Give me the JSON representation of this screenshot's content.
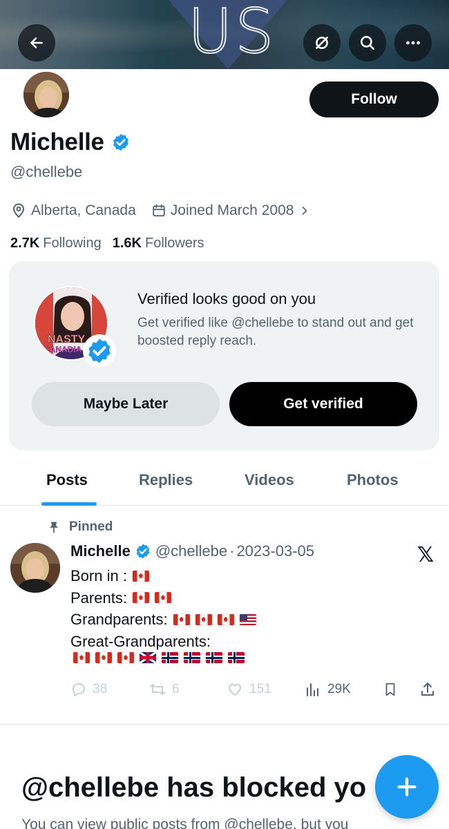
{
  "banner": {
    "text": "US"
  },
  "header": {
    "follow_label": "Follow",
    "name": "Michelle",
    "handle": "@chellebe",
    "location": "Alberta, Canada",
    "joined": "Joined March 2008",
    "following_count": "2.7K",
    "following_label": "Following",
    "followers_count": "1.6K",
    "followers_label": "Followers"
  },
  "verify_card": {
    "title": "Verified looks good on you",
    "description": "Get verified like @chellebe to stand out and get boosted reply reach.",
    "avatar_text_1": "NASTY",
    "avatar_text_2": "CANADIA",
    "later_label": "Maybe Later",
    "verify_label": "Get verified"
  },
  "tabs": [
    {
      "label": "Posts",
      "active": true
    },
    {
      "label": "Replies",
      "active": false
    },
    {
      "label": "Videos",
      "active": false
    },
    {
      "label": "Photos",
      "active": false
    }
  ],
  "post": {
    "pinned_label": "Pinned",
    "author": "Michelle",
    "handle": "@chellebe",
    "separator": "·",
    "date": "2023-03-05",
    "lines": [
      {
        "text": "Born in :",
        "flags": [
          "ca"
        ]
      },
      {
        "text": "Parents:",
        "flags": [
          "ca",
          "ca"
        ]
      },
      {
        "text": "Grandparents:",
        "flags": [
          "ca",
          "ca",
          "ca",
          "us"
        ]
      },
      {
        "text": "Great-Grandparents:",
        "flags": []
      },
      {
        "text": "",
        "flags": [
          "ca",
          "ca",
          "ca",
          "uk",
          "no",
          "no",
          "no",
          "no"
        ]
      }
    ],
    "replies": "38",
    "reposts": "6",
    "likes": "151",
    "views": "29K"
  },
  "blocked": {
    "title": "@chellebe has blocked yo",
    "description": "You can view public posts from @chellebe, but you"
  },
  "colors": {
    "accent": "#1d9bf0",
    "text": "#0f1419",
    "muted": "#536471"
  }
}
